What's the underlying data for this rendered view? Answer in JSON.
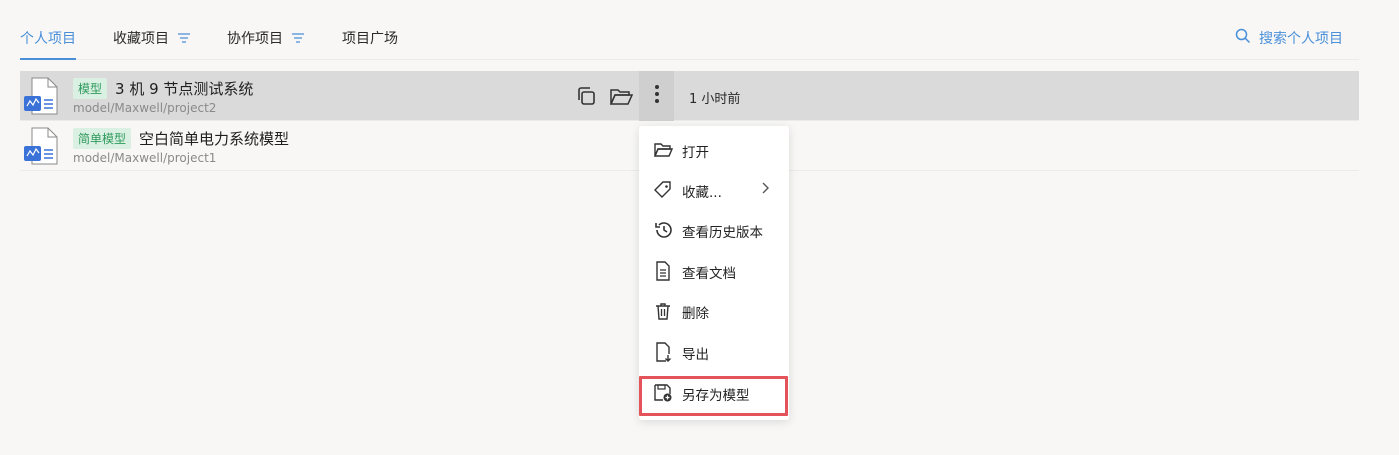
{
  "tabs": [
    {
      "label": "个人项目",
      "active": true
    },
    {
      "label": "收藏项目",
      "active": false
    },
    {
      "label": "协作项目",
      "active": false
    },
    {
      "label": "项目广场",
      "active": false
    }
  ],
  "search": {
    "label": "搜索个人项目",
    "icon": "search-icon"
  },
  "projects": [
    {
      "tag": "模型",
      "title": "3 机 9 节点测试系统",
      "path": "model/Maxwell/project2",
      "time": "1 小时前"
    },
    {
      "tag": "简单模型",
      "title": "空白简单电力系统模型",
      "path": "model/Maxwell/project1"
    }
  ],
  "context_menu": {
    "items": [
      {
        "label": "打开",
        "icon": "folder-open-icon"
      },
      {
        "label": "收藏...",
        "icon": "tag-icon",
        "submenu": true
      },
      {
        "label": "查看历史版本",
        "icon": "history-icon"
      },
      {
        "label": "查看文档",
        "icon": "document-icon"
      },
      {
        "label": "删除",
        "icon": "trash-icon"
      },
      {
        "label": "导出",
        "icon": "export-icon"
      },
      {
        "label": "另存为模型",
        "icon": "save-as-icon"
      }
    ]
  },
  "colors": {
    "accent": "#4a90d9",
    "tag_bg": "#daf0e3",
    "tag_text": "#2f9a5c",
    "highlight": "#e5535a"
  }
}
